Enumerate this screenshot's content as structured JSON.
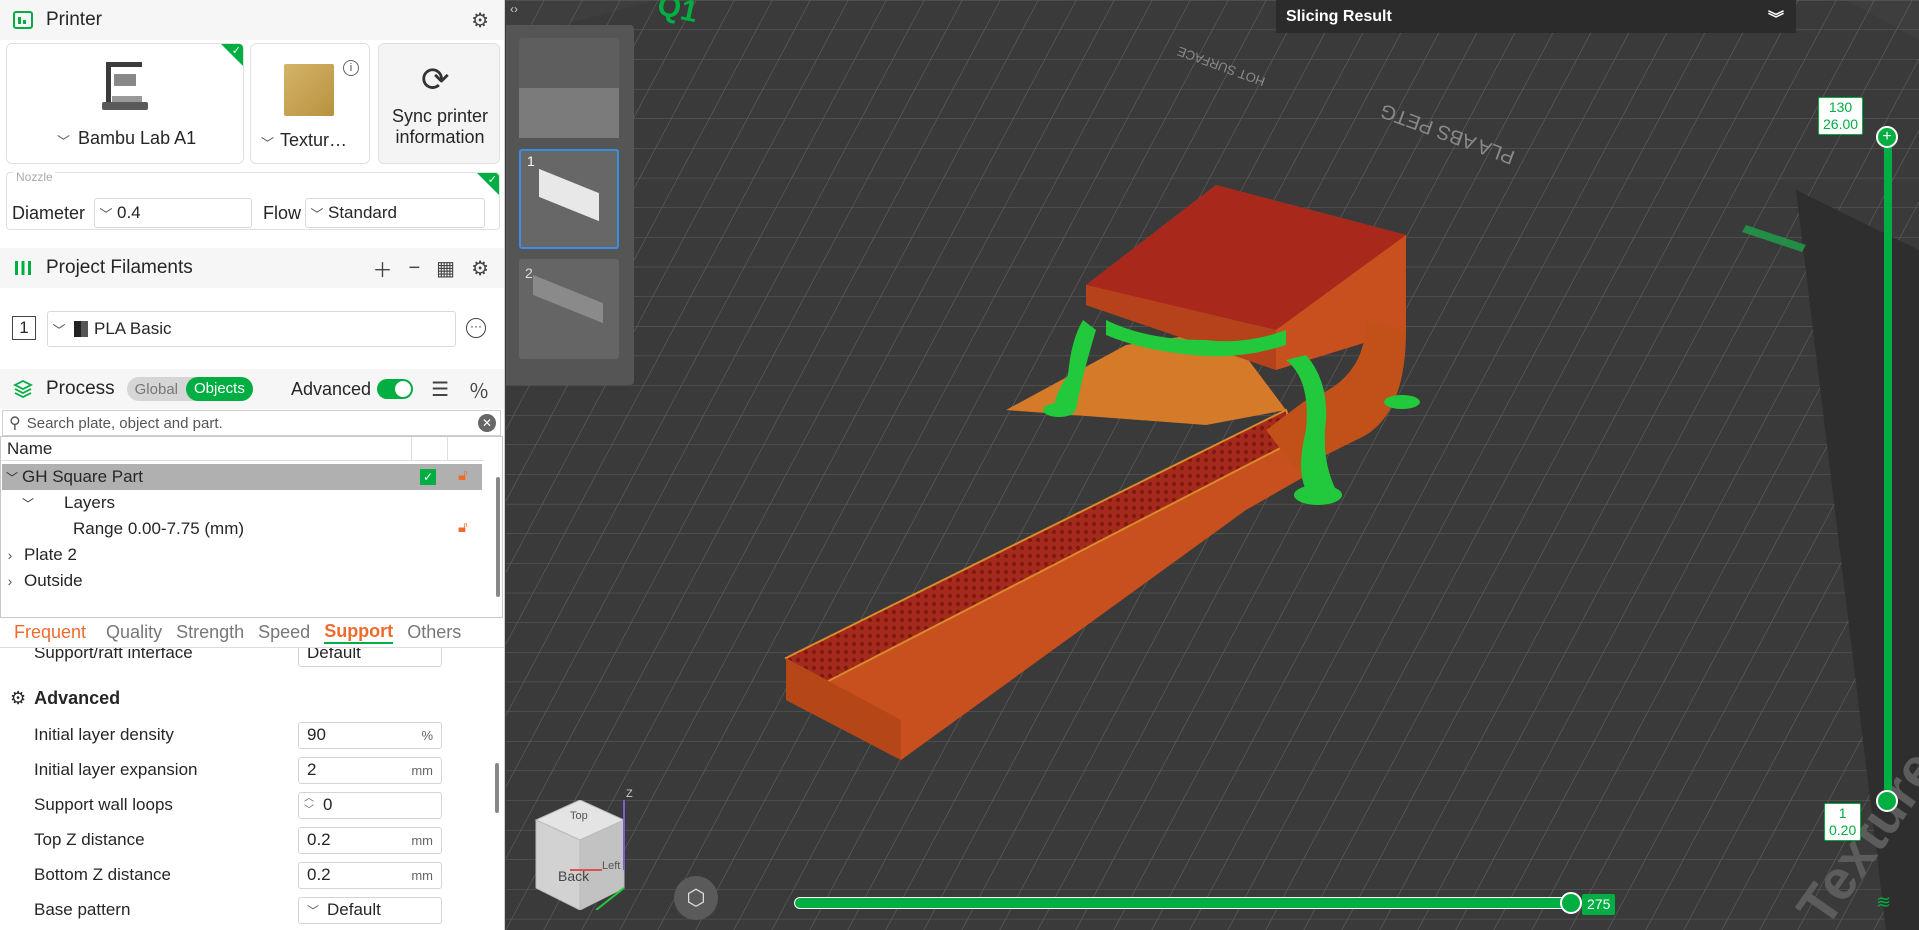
{
  "printer": {
    "title": "Printer",
    "printer_name": "Bambu Lab A1",
    "plate_name": "Textur…",
    "sync_label": "Sync printer information",
    "nozzle_label": "Nozzle",
    "diameter_label": "Diameter",
    "diameter_value": "0.4",
    "flow_label": "Flow",
    "flow_value": "Standard"
  },
  "filaments": {
    "title": "Project Filaments",
    "items": [
      {
        "index": "1",
        "name": "PLA Basic"
      }
    ]
  },
  "process": {
    "title": "Process",
    "toggle_global": "Global",
    "toggle_objects": "Objects",
    "advanced_label": "Advanced",
    "search_placeholder": "Search plate, object and part."
  },
  "tree": {
    "header": "Name",
    "rows": [
      {
        "label": "GH Square Part"
      },
      {
        "label": "Layers"
      },
      {
        "label": "Range 0.00-7.75 (mm)"
      },
      {
        "label": "Plate 2"
      },
      {
        "label": "Outside"
      }
    ]
  },
  "tabs": [
    "Frequent",
    "Quality",
    "Strength",
    "Speed",
    "Support",
    "Others"
  ],
  "settings": {
    "cut_row_label": "Support/raft interface",
    "cut_row_value": "Default",
    "group_title": "Advanced",
    "params": [
      {
        "label": "Initial layer density",
        "value": "90",
        "unit": "%"
      },
      {
        "label": "Initial layer expansion",
        "value": "2",
        "unit": "mm"
      },
      {
        "label": "Support wall loops",
        "value": "0",
        "unit": ""
      },
      {
        "label": "Top Z distance",
        "value": "0.2",
        "unit": "mm"
      },
      {
        "label": "Bottom Z distance",
        "value": "0.2",
        "unit": "mm"
      },
      {
        "label": "Base pattern",
        "value": "Default",
        "unit": ""
      }
    ]
  },
  "viewport": {
    "slicing_result": "Slicing Result",
    "plate_labels": [
      "1",
      "2"
    ],
    "layer_top_num": "130",
    "layer_top_height": "26.00",
    "layer_bottom_num": "1",
    "layer_bottom_height": "0.20",
    "h_slider_value": "275",
    "plate_text": "Textured PEI Plate",
    "cube_back": "Back",
    "cube_top": "Top",
    "cube_left": "Left",
    "axis_z": "Z",
    "bed_corner_text": "Q1",
    "bed_back_text": "PLA ABS PETG",
    "bed_hot_surface": "HOT SURFACE"
  },
  "colors": {
    "accent": "#00ae42",
    "orange": "#ee6b2c",
    "model": "#c8501e",
    "infill": "#a82020",
    "support": "#22c93c"
  }
}
